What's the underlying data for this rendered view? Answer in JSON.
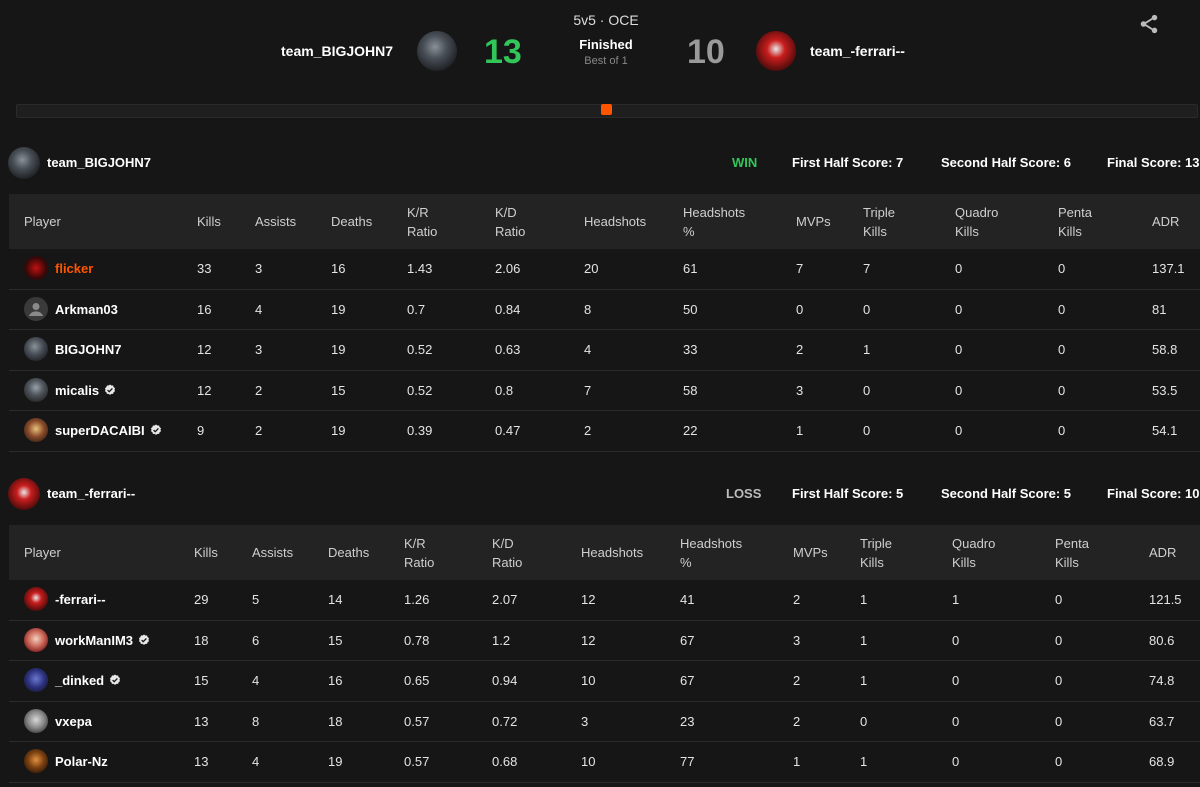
{
  "match": {
    "mode": "5v5 · OCE",
    "status": "Finished",
    "best_of": "Best of 1",
    "team1_name": "team_BIGJOHN7",
    "team1_score": "13",
    "team2_name": "team_-ferrari--",
    "team2_score": "10",
    "round_progress": 0.5
  },
  "colors": {
    "accent": "#ff5500",
    "win": "#32c65a",
    "background": "#161616"
  },
  "columns": [
    "Player",
    "Kills",
    "Assists",
    "Deaths",
    "K/R Ratio",
    "K/D Ratio",
    "Headshots",
    "Headshots %",
    "MVPs",
    "Triple Kills",
    "Quadro Kills",
    "Penta Kills",
    "ADR"
  ],
  "teams": [
    {
      "name": "team_BIGJOHN7",
      "result": "WIN",
      "first_half": "First Half Score: 7",
      "second_half": "Second Half Score: 6",
      "final": "Final Score: 13",
      "players": [
        {
          "name": "flicker",
          "verified": false,
          "highlight": true,
          "kills": "33",
          "assists": "3",
          "deaths": "16",
          "kr": "1.43",
          "kd": "2.06",
          "hs": "20",
          "hsp": "61",
          "mvps": "7",
          "triple": "7",
          "quadro": "0",
          "penta": "0",
          "adr": "137.1"
        },
        {
          "name": "Arkman03",
          "verified": false,
          "highlight": false,
          "kills": "16",
          "assists": "4",
          "deaths": "19",
          "kr": "0.7",
          "kd": "0.84",
          "hs": "8",
          "hsp": "50",
          "mvps": "0",
          "triple": "0",
          "quadro": "0",
          "penta": "0",
          "adr": "81"
        },
        {
          "name": "BIGJOHN7",
          "verified": false,
          "highlight": false,
          "kills": "12",
          "assists": "3",
          "deaths": "19",
          "kr": "0.52",
          "kd": "0.63",
          "hs": "4",
          "hsp": "33",
          "mvps": "2",
          "triple": "1",
          "quadro": "0",
          "penta": "0",
          "adr": "58.8"
        },
        {
          "name": "micalis",
          "verified": true,
          "highlight": false,
          "kills": "12",
          "assists": "2",
          "deaths": "15",
          "kr": "0.52",
          "kd": "0.8",
          "hs": "7",
          "hsp": "58",
          "mvps": "3",
          "triple": "0",
          "quadro": "0",
          "penta": "0",
          "adr": "53.5"
        },
        {
          "name": "superDACAIBI",
          "verified": true,
          "highlight": false,
          "kills": "9",
          "assists": "2",
          "deaths": "19",
          "kr": "0.39",
          "kd": "0.47",
          "hs": "2",
          "hsp": "22",
          "mvps": "1",
          "triple": "0",
          "quadro": "0",
          "penta": "0",
          "adr": "54.1"
        }
      ]
    },
    {
      "name": "team_-ferrari--",
      "result": "LOSS",
      "first_half": "First Half Score: 5",
      "second_half": "Second Half Score: 5",
      "final": "Final Score: 10",
      "players": [
        {
          "name": "-ferrari--",
          "verified": false,
          "highlight": false,
          "kills": "29",
          "assists": "5",
          "deaths": "14",
          "kr": "1.26",
          "kd": "2.07",
          "hs": "12",
          "hsp": "41",
          "mvps": "2",
          "triple": "1",
          "quadro": "1",
          "penta": "0",
          "adr": "121.5"
        },
        {
          "name": "workManIM3",
          "verified": true,
          "highlight": false,
          "kills": "18",
          "assists": "6",
          "deaths": "15",
          "kr": "0.78",
          "kd": "1.2",
          "hs": "12",
          "hsp": "67",
          "mvps": "3",
          "triple": "1",
          "quadro": "0",
          "penta": "0",
          "adr": "80.6"
        },
        {
          "name": "_dinked",
          "verified": true,
          "highlight": false,
          "kills": "15",
          "assists": "4",
          "deaths": "16",
          "kr": "0.65",
          "kd": "0.94",
          "hs": "10",
          "hsp": "67",
          "mvps": "2",
          "triple": "1",
          "quadro": "0",
          "penta": "0",
          "adr": "74.8"
        },
        {
          "name": "vxepa",
          "verified": false,
          "highlight": false,
          "kills": "13",
          "assists": "8",
          "deaths": "18",
          "kr": "0.57",
          "kd": "0.72",
          "hs": "3",
          "hsp": "23",
          "mvps": "2",
          "triple": "0",
          "quadro": "0",
          "penta": "0",
          "adr": "63.7"
        },
        {
          "name": "Polar-Nz",
          "verified": false,
          "highlight": false,
          "kills": "13",
          "assists": "4",
          "deaths": "19",
          "kr": "0.57",
          "kd": "0.68",
          "hs": "10",
          "hsp": "77",
          "mvps": "1",
          "triple": "1",
          "quadro": "0",
          "penta": "0",
          "adr": "68.9"
        }
      ]
    }
  ]
}
